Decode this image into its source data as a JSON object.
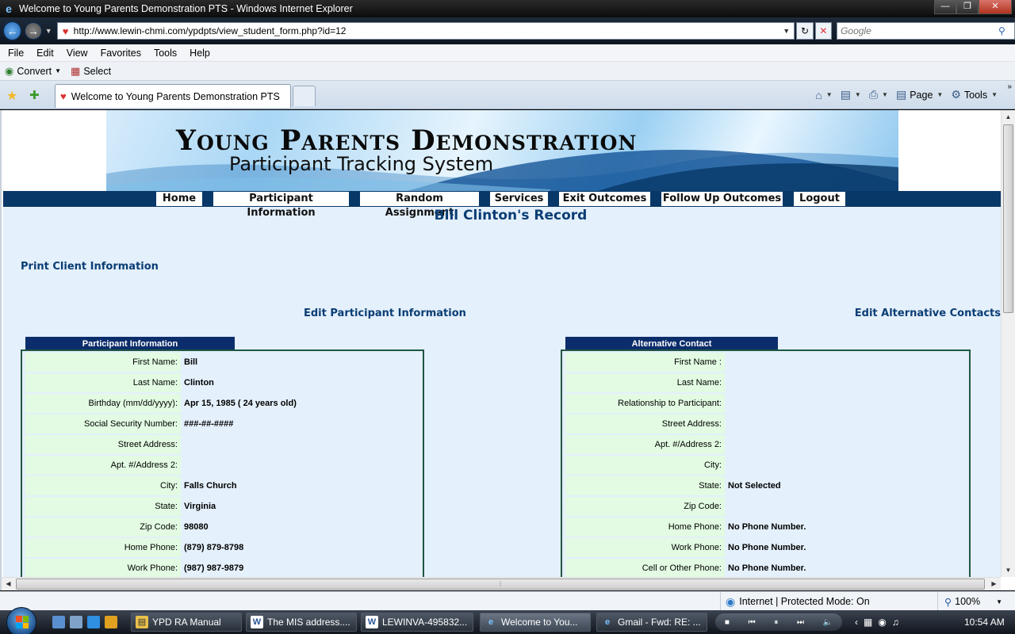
{
  "window": {
    "title": "Welcome to Young Parents Demonstration PTS - Windows Internet Explorer"
  },
  "addressbar": {
    "url": "http://www.lewin-chmi.com/ypdpts/view_student_form.php?id=12",
    "search_placeholder": "Google"
  },
  "menu": [
    "File",
    "Edit",
    "View",
    "Favorites",
    "Tools",
    "Help"
  ],
  "toolbar": {
    "convert": "Convert",
    "select": "Select"
  },
  "tab": {
    "title": "Welcome to Young Parents Demonstration PTS"
  },
  "commandbar": {
    "page": "Page",
    "tools": "Tools"
  },
  "banner": {
    "title": "Young Parents Demonstration",
    "subtitle": "Participant Tracking System"
  },
  "nav": [
    "Home",
    "Participant Information",
    "Random Assignment",
    "Services",
    "Exit Outcomes",
    "Follow Up Outcomes",
    "Logout"
  ],
  "record_title": "Bill Clinton's Record",
  "links": {
    "print": "Print Client Information",
    "edit_participant": "Edit Participant Information",
    "edit_alternative": "Edit Alternative Contacts"
  },
  "participant_panel": {
    "header": "Participant Information",
    "rows": [
      {
        "label": "First Name:",
        "value": "Bill"
      },
      {
        "label": "Last Name:",
        "value": "Clinton"
      },
      {
        "label": "Birthday (mm/dd/yyyy):",
        "value": "Apr 15, 1985 ( 24 years old)"
      },
      {
        "label": "Social Security Number:",
        "value": "###-##-####"
      },
      {
        "label": "Street Address:",
        "value": ""
      },
      {
        "label": "Apt. #/Address 2:",
        "value": ""
      },
      {
        "label": "City:",
        "value": "Falls Church"
      },
      {
        "label": "State:",
        "value": "Virginia"
      },
      {
        "label": "Zip Code:",
        "value": "98080"
      },
      {
        "label": "Home Phone:",
        "value": "(879) 879-8798"
      },
      {
        "label": "Work Phone:",
        "value": "(987) 987-9879"
      }
    ]
  },
  "alternative_panel": {
    "header": "Alternative Contact",
    "rows": [
      {
        "label": "First Name :",
        "value": ""
      },
      {
        "label": "Last Name:",
        "value": ""
      },
      {
        "label": "Relationship to Participant:",
        "value": ""
      },
      {
        "label": "Street Address:",
        "value": ""
      },
      {
        "label": "Apt. #/Address 2:",
        "value": ""
      },
      {
        "label": "City:",
        "value": ""
      },
      {
        "label": "State:",
        "value": "Not Selected"
      },
      {
        "label": "Zip Code:",
        "value": ""
      },
      {
        "label": "Home Phone:",
        "value": "No Phone Number."
      },
      {
        "label": "Work Phone:",
        "value": "No Phone Number."
      },
      {
        "label": "Cell or Other Phone:",
        "value": "No Phone Number."
      }
    ]
  },
  "statusbar": {
    "zone": "Internet | Protected Mode: On",
    "zoom": "100%"
  },
  "taskbar": {
    "tasks": [
      "YPD RA Manual",
      "The MIS address....",
      "LEWINVA-495832...",
      "Welcome to You...",
      "Gmail - Fwd: RE: ..."
    ],
    "clock": "10:54 AM"
  }
}
